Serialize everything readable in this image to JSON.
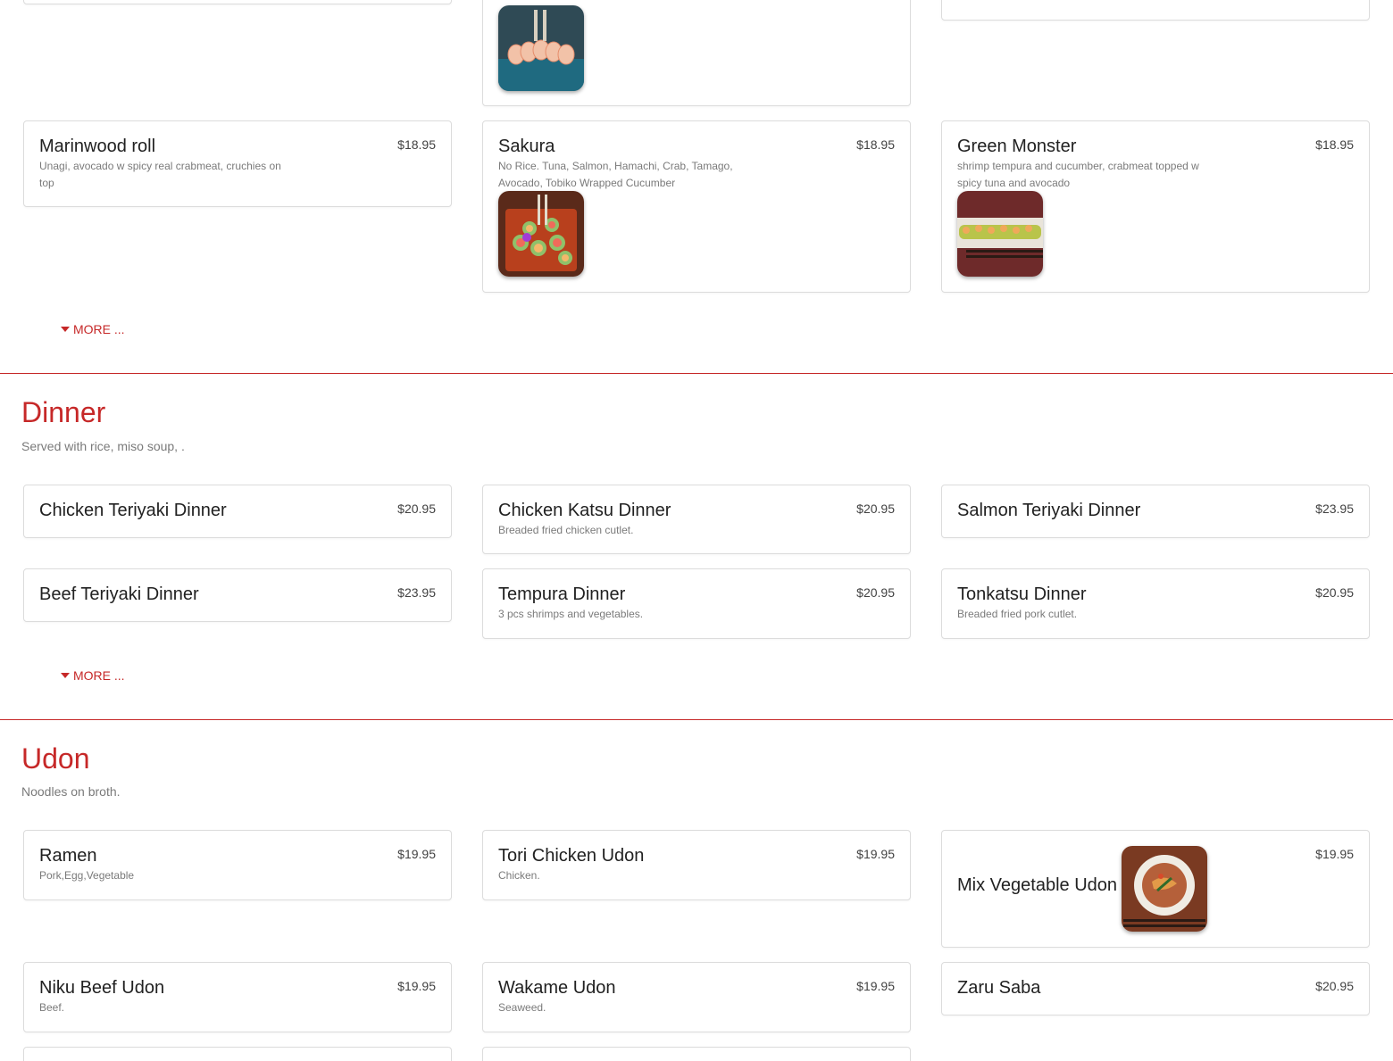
{
  "sushi": {
    "more_label": "MORE ...",
    "items": [
      {
        "name": "Marinwood roll",
        "price": "$18.95",
        "desc": "Unagi, avocado w spicy real crabmeat, cruchies on top"
      },
      {
        "name": "Sakura",
        "price": "$18.95",
        "desc": "No Rice. Tuna, Salmon, Hamachi, Crab, Tamago, Avocado, Tobiko Wrapped Cucumber"
      },
      {
        "name": "Green Monster",
        "price": "$18.95",
        "desc": "shrimp tempura and cucumber, crabmeat topped w spicy tuna and avocado"
      }
    ]
  },
  "dinner": {
    "title": "Dinner",
    "subtitle": "Served with rice, miso soup, .",
    "more_label": "MORE ...",
    "items": [
      {
        "name": "Chicken Teriyaki Dinner",
        "price": "$20.95"
      },
      {
        "name": "Chicken Katsu Dinner",
        "price": "$20.95",
        "desc": "Breaded fried chicken cutlet."
      },
      {
        "name": "Salmon Teriyaki Dinner",
        "price": "$23.95"
      },
      {
        "name": "Beef Teriyaki Dinner",
        "price": "$23.95"
      },
      {
        "name": "Tempura Dinner",
        "price": "$20.95",
        "desc": "3 pcs shrimps and vegetables."
      },
      {
        "name": "Tonkatsu Dinner",
        "price": "$20.95",
        "desc": "Breaded fried pork cutlet."
      }
    ]
  },
  "udon": {
    "title": "Udon",
    "subtitle": "Noodles on broth.",
    "items": [
      {
        "name": "Ramen",
        "price": "$19.95",
        "desc": "Pork,Egg,Vegetable"
      },
      {
        "name": "Tori Chicken Udon",
        "price": "$19.95",
        "desc": "Chicken."
      },
      {
        "name": "Mix Vegetable Udon",
        "price": "$19.95"
      },
      {
        "name": "Niku Beef Udon",
        "price": "$19.95",
        "desc": "Beef."
      },
      {
        "name": "Wakame Udon",
        "price": "$19.95",
        "desc": "Seaweed."
      },
      {
        "name": "Zaru Saba",
        "price": "$20.95"
      }
    ]
  },
  "colors": {
    "accent": "#c62828",
    "border": "#dcdcdc",
    "muted": "#7a7a7a"
  }
}
